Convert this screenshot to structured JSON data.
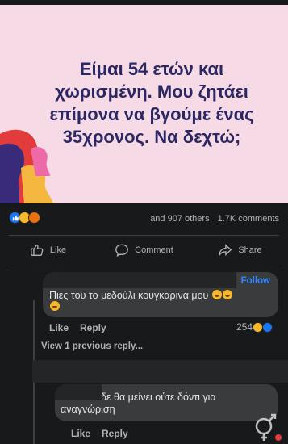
{
  "post": {
    "headline_lines": [
      "Είμαι 54 ετών και",
      "χωρισμένη. Μου ζητάει",
      "επίμονα να βγούμε ένας",
      "35χρονος. Να δεχτώ;"
    ]
  },
  "reactions": {
    "icons": [
      "like-icon",
      "haha-icon",
      "angry-icon"
    ],
    "others": "and 907 others",
    "comments": "1.7K comments"
  },
  "actions": {
    "like": "Like",
    "comment": "Comment",
    "share": "Share"
  },
  "comment1": {
    "follow": "Follow",
    "text": "Πιες του το μεδούλι κουγκαρινα μου",
    "like": "Like",
    "reply": "Reply",
    "reaction_count": "254"
  },
  "thread": {
    "view_previous": "View 1 previous reply..."
  },
  "comment2": {
    "text_line1": "δε θα μείνει ούτε δόντι για",
    "text_line2": "αναγνώριση",
    "like": "Like",
    "reply": "Reply"
  },
  "colors": {
    "background": "#18191a",
    "bubble": "#3a3b3c",
    "text": "#e4e6eb",
    "muted": "#b0b3b8",
    "accent": "#2d88ff",
    "image_bg": "#f6dbe6",
    "headline": "#2b2763"
  }
}
